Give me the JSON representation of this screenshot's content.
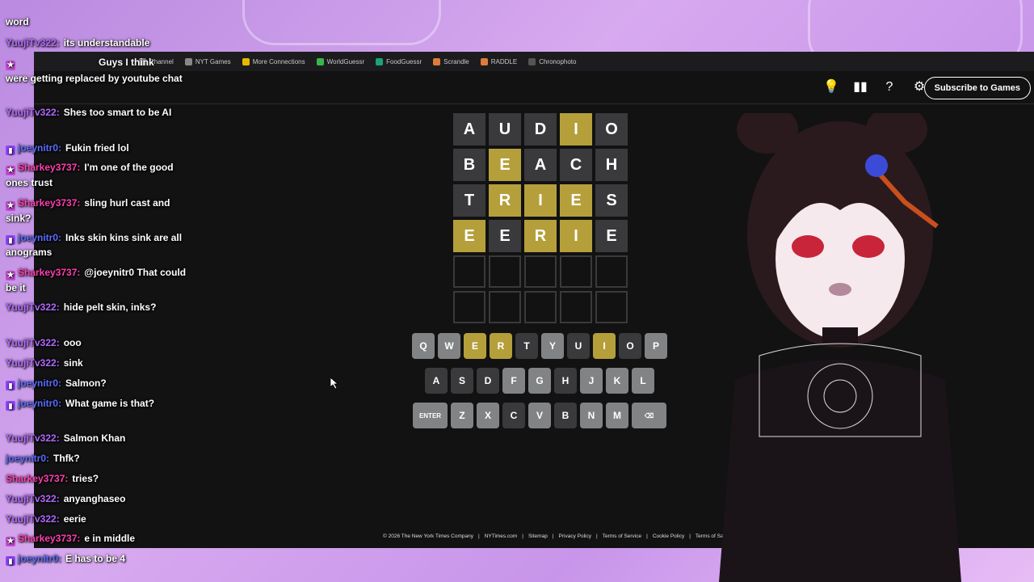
{
  "bookmarks": [
    {
      "label": "Channel",
      "icon": "channel-icon",
      "color": "#888888"
    },
    {
      "label": "NYT Games",
      "icon": "nyt-games-icon",
      "color": "#888888"
    },
    {
      "label": "More Connections",
      "icon": "grid-icon",
      "color": "#e6b800"
    },
    {
      "label": "WorldGuessr",
      "icon": "globe-icon",
      "color": "#3bb54a"
    },
    {
      "label": "FoodGuessr",
      "icon": "food-icon",
      "color": "#1aa37a"
    },
    {
      "label": "Scrandle",
      "icon": "scrandle-icon",
      "color": "#e07b39"
    },
    {
      "label": "RADDLE",
      "icon": "raddle-icon",
      "color": "#e07b39"
    },
    {
      "label": "Chronophoto",
      "icon": "camera-icon",
      "color": "#555555"
    }
  ],
  "header": {
    "subscribe_label": "Subscribe to Games",
    "overlay_text": "Guys I think"
  },
  "board": {
    "rows": [
      [
        {
          "l": "A",
          "s": "absent"
        },
        {
          "l": "U",
          "s": "absent"
        },
        {
          "l": "D",
          "s": "absent"
        },
        {
          "l": "I",
          "s": "present"
        },
        {
          "l": "O",
          "s": "absent"
        }
      ],
      [
        {
          "l": "B",
          "s": "absent"
        },
        {
          "l": "E",
          "s": "present"
        },
        {
          "l": "A",
          "s": "absent"
        },
        {
          "l": "C",
          "s": "absent"
        },
        {
          "l": "H",
          "s": "absent"
        }
      ],
      [
        {
          "l": "T",
          "s": "absent"
        },
        {
          "l": "R",
          "s": "present"
        },
        {
          "l": "I",
          "s": "present"
        },
        {
          "l": "E",
          "s": "present"
        },
        {
          "l": "S",
          "s": "absent"
        }
      ],
      [
        {
          "l": "E",
          "s": "present"
        },
        {
          "l": "E",
          "s": "absent"
        },
        {
          "l": "R",
          "s": "present"
        },
        {
          "l": "I",
          "s": "present"
        },
        {
          "l": "E",
          "s": "absent"
        }
      ],
      [
        {
          "l": "",
          "s": "empty"
        },
        {
          "l": "",
          "s": "empty"
        },
        {
          "l": "",
          "s": "empty"
        },
        {
          "l": "",
          "s": "empty"
        },
        {
          "l": "",
          "s": "empty"
        }
      ],
      [
        {
          "l": "",
          "s": "empty"
        },
        {
          "l": "",
          "s": "empty"
        },
        {
          "l": "",
          "s": "empty"
        },
        {
          "l": "",
          "s": "empty"
        },
        {
          "l": "",
          "s": "empty"
        }
      ]
    ]
  },
  "keyboard": {
    "rows": [
      [
        {
          "k": "Q",
          "s": "unused"
        },
        {
          "k": "W",
          "s": "unused"
        },
        {
          "k": "E",
          "s": "present"
        },
        {
          "k": "R",
          "s": "present"
        },
        {
          "k": "T",
          "s": "absent"
        },
        {
          "k": "Y",
          "s": "unused"
        },
        {
          "k": "U",
          "s": "absent"
        },
        {
          "k": "I",
          "s": "present"
        },
        {
          "k": "O",
          "s": "absent"
        },
        {
          "k": "P",
          "s": "unused"
        }
      ],
      [
        {
          "k": "A",
          "s": "absent"
        },
        {
          "k": "S",
          "s": "absent"
        },
        {
          "k": "D",
          "s": "absent"
        },
        {
          "k": "F",
          "s": "unused"
        },
        {
          "k": "G",
          "s": "unused"
        },
        {
          "k": "H",
          "s": "absent"
        },
        {
          "k": "J",
          "s": "unused"
        },
        {
          "k": "K",
          "s": "unused"
        },
        {
          "k": "L",
          "s": "unused"
        }
      ],
      [
        {
          "k": "ENTER",
          "s": "unused",
          "wide": true
        },
        {
          "k": "Z",
          "s": "unused"
        },
        {
          "k": "X",
          "s": "unused"
        },
        {
          "k": "C",
          "s": "absent"
        },
        {
          "k": "V",
          "s": "unused"
        },
        {
          "k": "B",
          "s": "absent"
        },
        {
          "k": "N",
          "s": "unused"
        },
        {
          "k": "M",
          "s": "unused"
        },
        {
          "k": "⌫",
          "s": "unused",
          "wide": true
        }
      ]
    ]
  },
  "footer": {
    "links": [
      "© 2026 The New York Times Company",
      "|",
      "NYTimes.com",
      "|",
      "Sitemap",
      "|",
      "Privacy Policy",
      "|",
      "Terms of Service",
      "|",
      "Cookie Policy",
      "|",
      "Terms of Sale"
    ]
  },
  "chat": [
    {
      "badge": "",
      "user": "",
      "ucls": "u-purple",
      "text": "word"
    },
    {
      "badge": "",
      "user": "YuujiTv322:",
      "ucls": "u-purple",
      "text": "its understandable"
    },
    {
      "badge": "star",
      "user": "",
      "ucls": "u-pink",
      "text": ""
    },
    {
      "badge": "",
      "user": "",
      "ucls": "u-purple",
      "text": "were getting replaced by youtube chat"
    },
    {
      "badge": "",
      "user": "YuujiTv322:",
      "ucls": "u-purple",
      "text": "Shes too smart to be AI"
    },
    {
      "badge": "sub",
      "user": "joeynitr0:",
      "ucls": "u-blue",
      "text": "Fukin fried lol"
    },
    {
      "badge": "star",
      "user": "Sharkey3737:",
      "ucls": "u-pink",
      "text": "I'm one of the good ones trust"
    },
    {
      "badge": "star",
      "user": "Sharkey3737:",
      "ucls": "u-pink",
      "text": "sling hurl cast and sink?"
    },
    {
      "badge": "sub",
      "user": "joeynitr0:",
      "ucls": "u-blue",
      "text": "Inks skin kins sink are all anograms"
    },
    {
      "badge": "star",
      "user": "Sharkey3737:",
      "ucls": "u-pink",
      "text": "@joeynitr0 That could be it"
    },
    {
      "badge": "",
      "user": "YuujiTv322:",
      "ucls": "u-purple",
      "text": "hide pelt skin, inks?"
    },
    {
      "badge": "",
      "user": "YuujiTv322:",
      "ucls": "u-purple",
      "text": "ooo"
    },
    {
      "badge": "",
      "user": "YuujiTv322:",
      "ucls": "u-purple",
      "text": "sink"
    },
    {
      "badge": "sub",
      "user": "joeynitr0:",
      "ucls": "u-blue",
      "text": "Salmon?"
    },
    {
      "badge": "sub",
      "user": "joeynitr0:",
      "ucls": "u-blue",
      "text": "What game is that?"
    },
    {
      "badge": "",
      "user": "YuujiTv322:",
      "ucls": "u-purple",
      "text": "Salmon Khan"
    },
    {
      "badge": "",
      "user": "joeynitr0:",
      "ucls": "u-blue",
      "text": "Thfk?"
    },
    {
      "badge": "",
      "user": "Sharkey3737:",
      "ucls": "u-pink",
      "text": "tries?"
    },
    {
      "badge": "",
      "user": "YuujiTv322:",
      "ucls": "u-purple",
      "text": "anyanghaseo"
    },
    {
      "badge": "",
      "user": "YuujiTv322:",
      "ucls": "u-purple",
      "text": "eerie"
    },
    {
      "badge": "star",
      "user": "Sharkey3737:",
      "ucls": "u-pink",
      "text": "e in middle"
    },
    {
      "badge": "sub",
      "user": "joeynitr0:",
      "ucls": "u-blue",
      "text": "E has to be 4"
    }
  ]
}
